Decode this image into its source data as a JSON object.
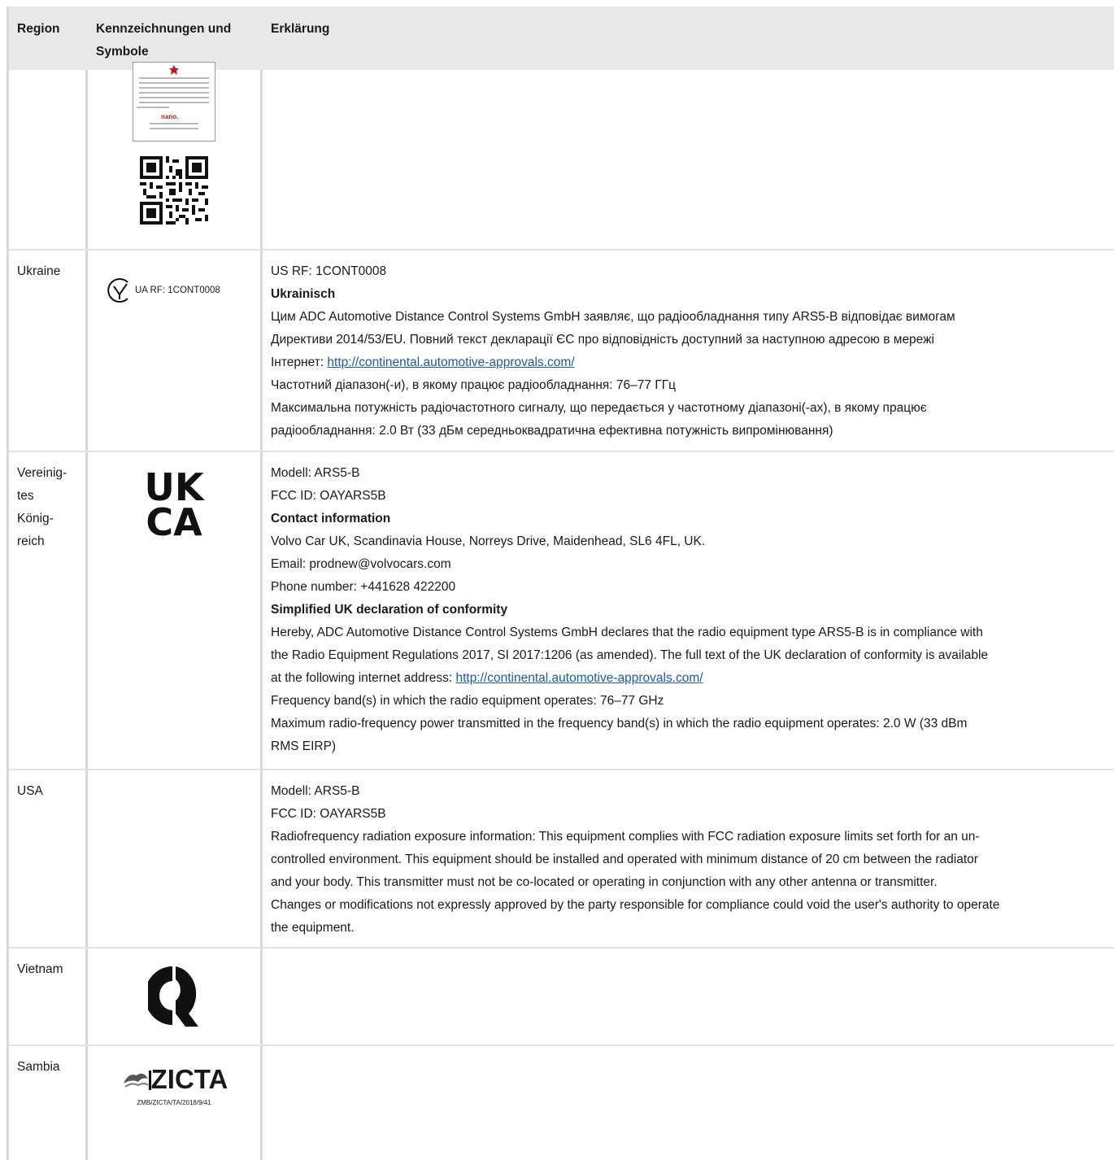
{
  "header": {
    "region": "Region",
    "symbols": "Kennzeichnungen und Symbole",
    "explanation": "Erklärung"
  },
  "thai": {
    "nano_text": "nano."
  },
  "ukraine": {
    "region": "Ukraine",
    "mark_text": "UA RF: 1CONT0008",
    "line1": "US RF: 1CONT0008",
    "heading": "Ukrainisch",
    "decl_a": "Цим ADC Automotive Distance Control Systems GmbH заявляє, що радіообладнання типу ARS5-B відповідає вимогам",
    "decl_b": "Директиви 2014/53/EU. Повний текст декларації ЄС про відповідність доступний за наступною адресою в мережі",
    "decl_c": "Інтернет: ",
    "link": "http://continental.automotive-approvals.com/",
    "freq": "Частотний діапазон(-и), в якому працює радіообладнання: 76–77 ГГц",
    "power_a": "Максимальна потужність радіочастотного сигналу, що передається у частотному діапазоні(-ах), в якому працює",
    "power_b": "радіообладнання: 2.0 Вт (33 дБм середньоквадратична ефективна потужність випромінювання)"
  },
  "uk": {
    "region_1": "Vereinig-",
    "region_2": "tes",
    "region_3": "König-",
    "region_4": "reich",
    "logo_top": "UK",
    "logo_bottom": "CA",
    "model": "Modell: ARS5-B",
    "fcc": "FCC ID: OAYARS5B",
    "contact_heading": "Contact information",
    "address": "Volvo Car UK, Scandinavia House, Norreys Drive, Maidenhead, SL6 4FL, UK.",
    "email": "Email: prodnew@volvocars.com",
    "phone": "Phone number: +441628 422200",
    "decl_heading": "Simplified UK declaration of conformity",
    "decl_a": "Hereby, ADC Automotive Distance Control Systems GmbH declares that the radio equipment type ARS5-B is in compliance with",
    "decl_b": "the Radio Equipment Regulations 2017, SI 2017:1206 (as amended). The full text of the UK declaration of conformity is available",
    "decl_c": "at the following internet address: ",
    "link": "http://continental.automotive-approvals.com/",
    "freq": "Frequency band(s) in which the radio equipment operates: 76–77 GHz",
    "power_a": "Maximum radio-frequency power transmitted in the frequency band(s) in which the radio equipment operates: 2.0 W (33 dBm",
    "power_b": "RMS EIRP)"
  },
  "usa": {
    "region": "USA",
    "model": "Modell: ARS5-B",
    "fcc": "FCC ID: OAYARS5B",
    "rf_a": "Radiofrequency radiation exposure information: This equipment complies with FCC radiation exposure limits set forth for an un-",
    "rf_b": "controlled environment. This equipment should be installed and operated with minimum distance of 20 cm between the radiator",
    "rf_c": "and your body. This transmitter must not be co-located or operating in conjunction with any other antenna or transmitter.",
    "rf_d": "Changes or modifications not expressly approved by the party responsible for compliance could void the user's authority to operate",
    "rf_e": "the equipment."
  },
  "vietnam": {
    "region": "Vietnam"
  },
  "zambia": {
    "region": "Sambia",
    "logo_text": "ZICTA",
    "code": "ZMB/ZICTA/TA/2018/9/41"
  },
  "colors": {
    "header_bg": "#e8e8e8",
    "link": "#1a5aa8",
    "border": "#d8d8d8"
  }
}
